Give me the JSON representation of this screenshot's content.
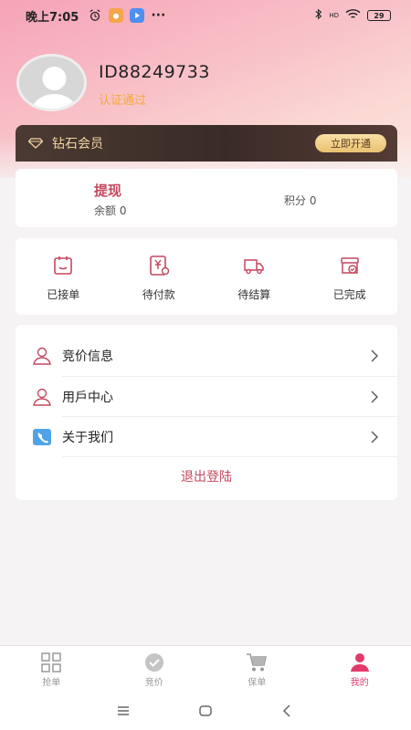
{
  "status_bar": {
    "time": "晚上7:05",
    "battery": "29",
    "network": "HD"
  },
  "profile": {
    "user_id": "ID88249733",
    "auth_status": "认证通过"
  },
  "vip": {
    "label": "钻石会员",
    "button": "立即开通"
  },
  "account": {
    "withdraw_label": "提现",
    "balance": "余额 0",
    "points": "积分 0"
  },
  "orders": [
    {
      "label": "已接单",
      "icon": "order-received-icon"
    },
    {
      "label": "待付款",
      "icon": "pending-payment-icon"
    },
    {
      "label": "待结算",
      "icon": "pending-settlement-icon"
    },
    {
      "label": "已完成",
      "icon": "completed-icon"
    }
  ],
  "menu": [
    {
      "label": "竞价信息",
      "icon": "person-outline-icon"
    },
    {
      "label": "用戶中心",
      "icon": "person-outline-icon"
    },
    {
      "label": "关于我们",
      "icon": "phone-icon"
    }
  ],
  "logout_label": "退出登陆",
  "tabs": [
    {
      "label": "抢单",
      "icon": "grid-icon"
    },
    {
      "label": "竞价",
      "icon": "check-circle-icon"
    },
    {
      "label": "保单",
      "icon": "cart-icon"
    },
    {
      "label": "我的",
      "icon": "profile-icon",
      "active": true
    }
  ],
  "colors": {
    "accent": "#c5475f",
    "active_tab": "#e23b6b",
    "vip_gold": "#f1d3a2",
    "auth_orange": "#f2a93b"
  }
}
